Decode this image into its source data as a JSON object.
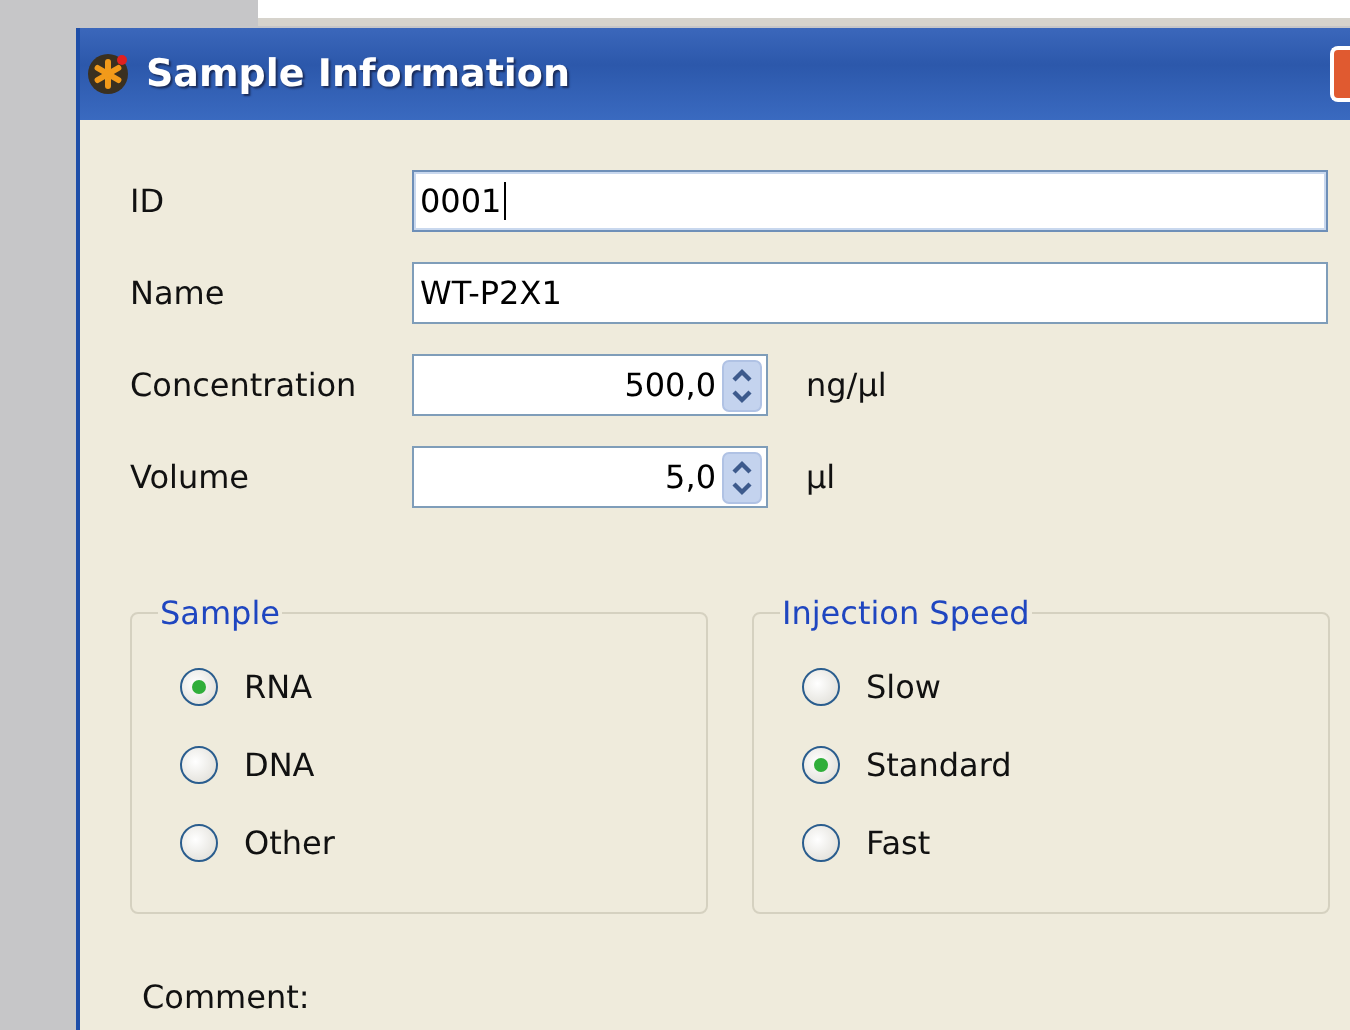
{
  "window": {
    "title": "Sample Information"
  },
  "fields": [
    {
      "label": "ID",
      "kind": "text",
      "value": "0001",
      "focused": true
    },
    {
      "label": "Name",
      "kind": "text",
      "value": "WT-P2X1",
      "focused": false
    },
    {
      "label": "Concentration",
      "kind": "spin",
      "value": "500,0",
      "unit": "ng/µl",
      "focused": false
    },
    {
      "label": "Volume",
      "kind": "spin",
      "value": "5,0",
      "unit": "µl",
      "focused": false
    }
  ],
  "groups": [
    {
      "title": "Sample",
      "options": [
        {
          "label": "RNA",
          "selected": true
        },
        {
          "label": "DNA",
          "selected": false
        },
        {
          "label": "Other",
          "selected": false
        }
      ]
    },
    {
      "title": "Injection Speed",
      "options": [
        {
          "label": "Slow",
          "selected": false
        },
        {
          "label": "Standard",
          "selected": true
        },
        {
          "label": "Fast",
          "selected": false
        }
      ]
    }
  ],
  "comment": {
    "label": "Comment:"
  }
}
